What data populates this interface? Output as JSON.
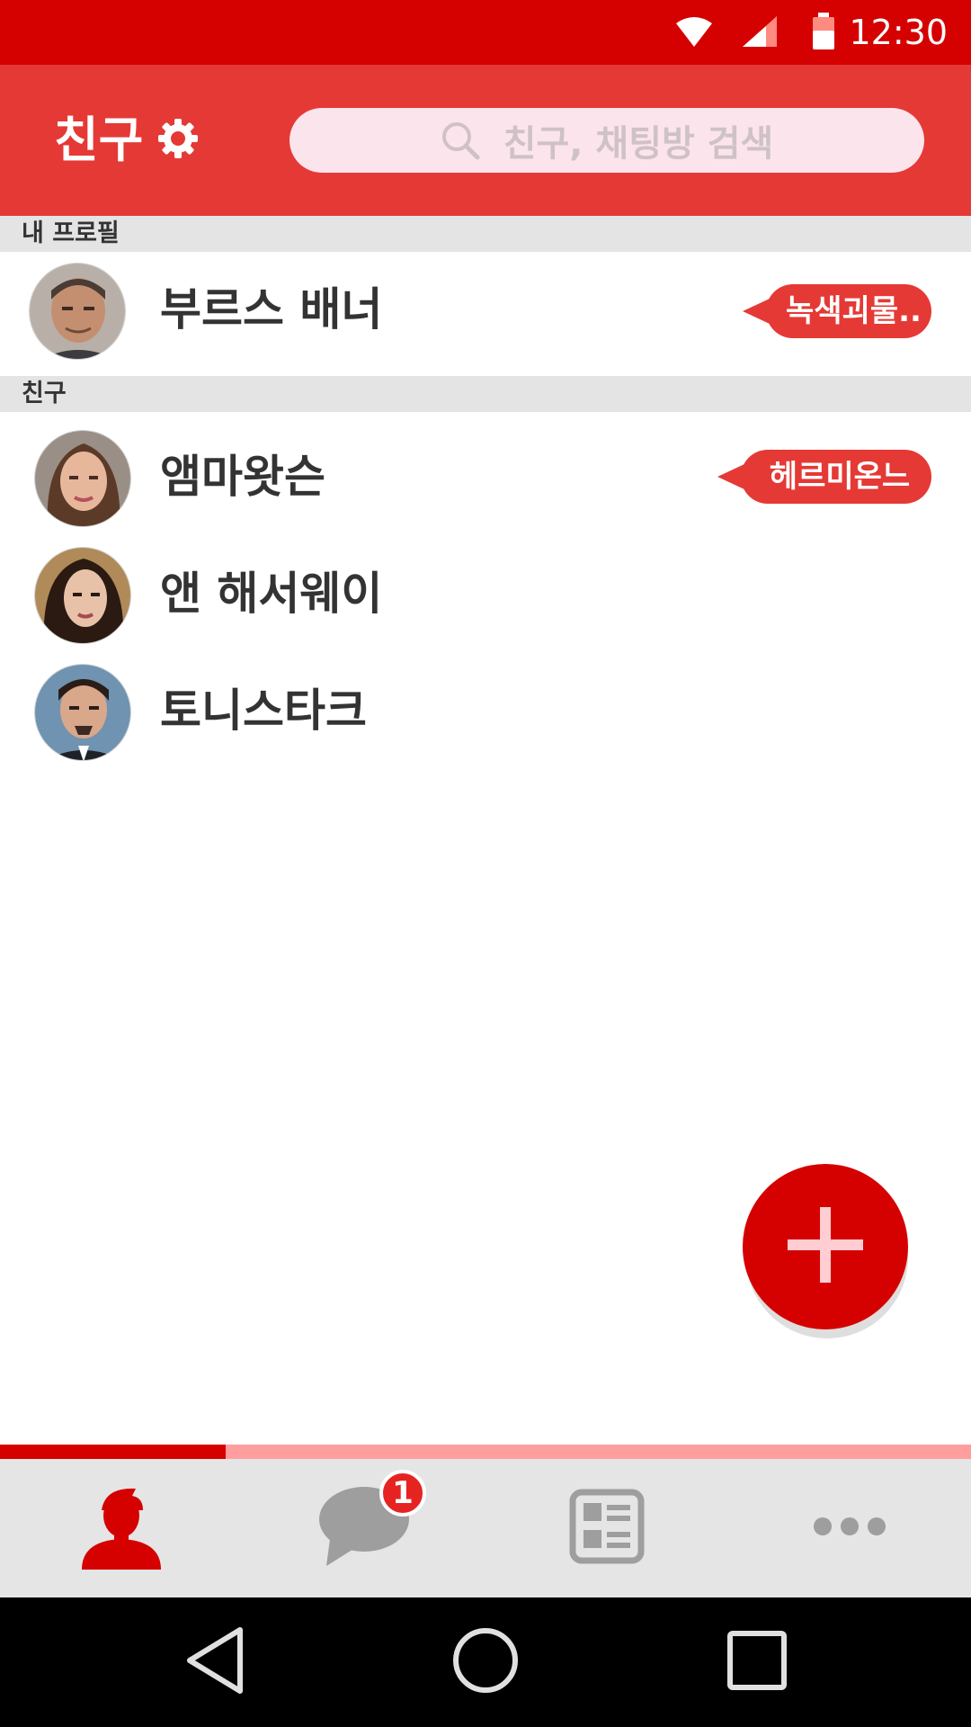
{
  "status_bar": {
    "time": "12:30",
    "icons": [
      "wifi-icon",
      "signal-icon",
      "battery-icon"
    ],
    "background": "#d50000"
  },
  "app_bar": {
    "title": "친구",
    "settings_icon": "gear-icon",
    "search": {
      "placeholder": "친구, 채팅방 검색",
      "icon": "search-icon"
    },
    "background": "#e53935"
  },
  "sections": {
    "my_profile": "내 프로필",
    "friends": "친구"
  },
  "my_profile": {
    "name": "부르스 배너",
    "status": "녹색괴물..",
    "avatar": "avatar-photo"
  },
  "friends": [
    {
      "name": "앰마왓슨",
      "status": "헤르미온느",
      "avatar": "avatar-photo"
    },
    {
      "name": "앤 해서웨이",
      "status": "",
      "avatar": "avatar-photo"
    },
    {
      "name": "토니스타크",
      "status": "",
      "avatar": "avatar-photo"
    }
  ],
  "fab": {
    "icon": "plus-icon",
    "color": "#d50000"
  },
  "bottom_nav": {
    "tabs": [
      {
        "id": "friends",
        "icon": "person-icon",
        "active": true
      },
      {
        "id": "chats",
        "icon": "chat-bubble-icon",
        "badge": "1"
      },
      {
        "id": "news",
        "icon": "news-icon"
      },
      {
        "id": "more",
        "icon": "more-dots-icon"
      }
    ],
    "active_color": "#d50000",
    "inactive_color": "#9e9e9e"
  },
  "system_nav": {
    "icons": [
      "back-icon",
      "home-icon",
      "recents-icon"
    ]
  }
}
